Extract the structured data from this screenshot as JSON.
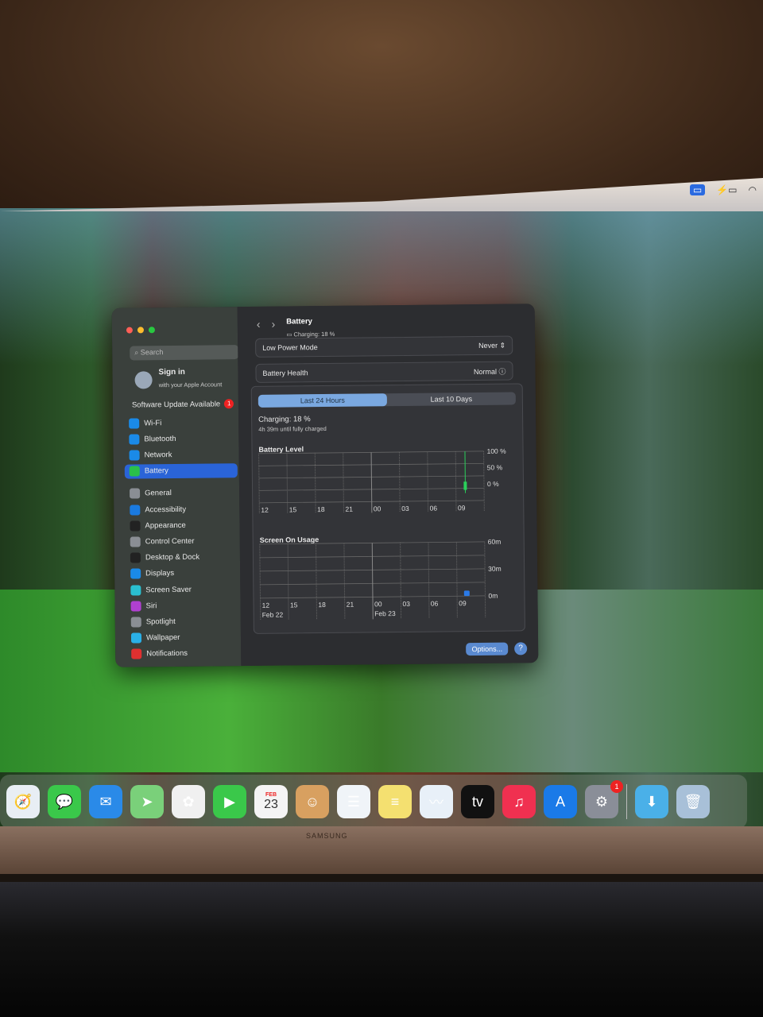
{
  "menubar": {
    "icons": [
      "screen-mirroring-icon",
      "battery-charging-icon",
      "wifi-icon"
    ]
  },
  "monitor": {
    "brand": "SAMSUNG"
  },
  "sidebar": {
    "search_placeholder": "Search",
    "signin_title": "Sign in",
    "signin_sub": "with your Apple Account",
    "update_label": "Software Update Available",
    "update_count": "1",
    "items": [
      {
        "label": "Wi-Fi",
        "color": "#1a8ae8",
        "icon": "wifi-icon"
      },
      {
        "label": "Bluetooth",
        "color": "#1a8ae8",
        "icon": "bluetooth-icon"
      },
      {
        "label": "Network",
        "color": "#1a8ae8",
        "icon": "globe-icon"
      },
      {
        "label": "Battery",
        "color": "#2ac04a",
        "icon": "battery-icon",
        "selected": true
      },
      {
        "label": "General",
        "color": "#8a8e94",
        "icon": "gear-icon"
      },
      {
        "label": "Accessibility",
        "color": "#1a7ae0",
        "icon": "accessibility-icon"
      },
      {
        "label": "Appearance",
        "color": "#222",
        "icon": "appearance-icon"
      },
      {
        "label": "Control Center",
        "color": "#8a8e94",
        "icon": "control-center-icon"
      },
      {
        "label": "Desktop & Dock",
        "color": "#222",
        "icon": "dock-icon"
      },
      {
        "label": "Displays",
        "color": "#1a8ae8",
        "icon": "sun-icon"
      },
      {
        "label": "Screen Saver",
        "color": "#2ac0d0",
        "icon": "screen-saver-icon"
      },
      {
        "label": "Siri",
        "color": "#b040d0",
        "icon": "siri-icon"
      },
      {
        "label": "Spotlight",
        "color": "#8a8e94",
        "icon": "magnifier-icon"
      },
      {
        "label": "Wallpaper",
        "color": "#2ab0e8",
        "icon": "flower-icon"
      },
      {
        "label": "Notifications",
        "color": "#e03030",
        "icon": "bell-icon"
      }
    ]
  },
  "main": {
    "title": "Battery",
    "subtitle": "Charging: 18 %",
    "low_power_label": "Low Power Mode",
    "low_power_value": "Never",
    "health_label": "Battery Health",
    "health_value": "Normal",
    "tabs": [
      "Last 24 Hours",
      "Last 10 Days"
    ],
    "active_tab": 0,
    "status": "Charging: 18 %",
    "status_sub": "4h 39m until fully charged",
    "options_label": "Options...",
    "help_label": "?"
  },
  "chart_data": [
    {
      "type": "bar",
      "title": "Battery Level",
      "x_ticks": [
        "12",
        "15",
        "18",
        "21",
        "00",
        "03",
        "06",
        "09"
      ],
      "y_ticks": [
        "100 %",
        "50 %",
        "0 %"
      ],
      "ylim": [
        0,
        100
      ],
      "color": "#2ad05a",
      "series": [
        {
          "x": "10:00",
          "value": 18
        }
      ]
    },
    {
      "type": "bar",
      "title": "Screen On Usage",
      "x_ticks": [
        "12",
        "15",
        "18",
        "21",
        "00",
        "03",
        "06",
        "09"
      ],
      "date_labels": [
        "Feb 22",
        "Feb 23"
      ],
      "y_ticks": [
        "60m",
        "30m",
        "0m"
      ],
      "ylim": [
        0,
        60
      ],
      "color": "#2a7ae8",
      "series": [
        {
          "x": "10:00",
          "value": 6
        }
      ]
    }
  ],
  "dock": [
    {
      "name": "safari",
      "color": "#e8eef4",
      "glyph": "🧭"
    },
    {
      "name": "messages",
      "color": "#3ac84a",
      "glyph": "💬"
    },
    {
      "name": "mail",
      "color": "#2a8ae8",
      "glyph": "✉"
    },
    {
      "name": "maps",
      "color": "#7ad07a",
      "glyph": "➤"
    },
    {
      "name": "photos",
      "color": "#f0f0f0",
      "glyph": "✿"
    },
    {
      "name": "facetime",
      "color": "#3ac84a",
      "glyph": "▶"
    },
    {
      "name": "calendar",
      "color": "#f4f4f4",
      "glyph": "23",
      "month": "FEB"
    },
    {
      "name": "contacts",
      "color": "#d8a060",
      "glyph": "☺"
    },
    {
      "name": "reminders",
      "color": "#f0f4f8",
      "glyph": "☰"
    },
    {
      "name": "notes",
      "color": "#f4e070",
      "glyph": "≡"
    },
    {
      "name": "freeform",
      "color": "#e8f0f8",
      "glyph": "〰"
    },
    {
      "name": "apple-tv",
      "color": "#111",
      "glyph": "tv"
    },
    {
      "name": "music",
      "color": "#f03050",
      "glyph": "♫"
    },
    {
      "name": "app-store",
      "color": "#1a7ae8",
      "glyph": "A"
    },
    {
      "name": "system-settings",
      "color": "#8a8e98",
      "glyph": "⚙",
      "badge": "1"
    },
    {
      "name": "downloads",
      "color": "#4ab0e8",
      "glyph": "⬇"
    },
    {
      "name": "trash",
      "color": "#a8c0d8",
      "glyph": "🗑"
    }
  ]
}
